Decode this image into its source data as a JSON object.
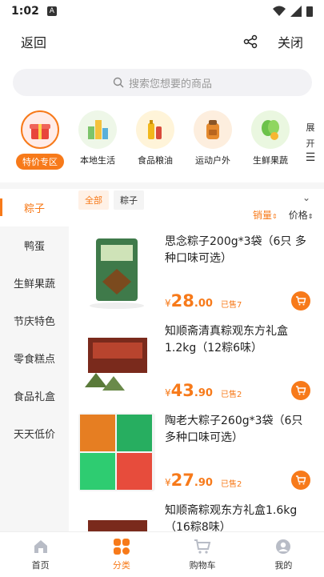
{
  "status_bar": {
    "time": "1:02",
    "notif": "A"
  },
  "header": {
    "back_label": "返回",
    "close_label": "关闭"
  },
  "search": {
    "placeholder": "搜索您想要的商品"
  },
  "categories": [
    {
      "label": "特价专区",
      "icon": "gift-box-icon",
      "active": true
    },
    {
      "label": "本地生活",
      "icon": "city-buildings-icon"
    },
    {
      "label": "食品粮油",
      "icon": "oil-bottles-icon"
    },
    {
      "label": "运动户外",
      "icon": "backpack-icon"
    },
    {
      "label": "生鲜果蔬",
      "icon": "vegetables-icon"
    }
  ],
  "expand_label": "展开",
  "sidebar": [
    {
      "label": "粽子",
      "active": true
    },
    {
      "label": "鸭蛋"
    },
    {
      "label": "生鲜果蔬"
    },
    {
      "label": "节庆特色"
    },
    {
      "label": "零食糕点"
    },
    {
      "label": "食品礼盒"
    },
    {
      "label": "天天低价"
    }
  ],
  "filters": {
    "all": "全部",
    "zongzi": "粽子",
    "sort_sales": "销量",
    "sort_price": "价格"
  },
  "products": [
    {
      "title": "思念粽子200g*3袋（6只 多种口味可选）",
      "currency": "¥",
      "price_int": "28",
      "price_dec": ".00",
      "sold": "已售7"
    },
    {
      "title": "知顺斋清真粽观东方礼盒1.2kg（12粽6味）",
      "currency": "¥",
      "price_int": "43",
      "price_dec": ".90",
      "sold": "已售2"
    },
    {
      "title": "陶老大粽子260g*3袋（6只多种口味可选）",
      "currency": "¥",
      "price_int": "27",
      "price_dec": ".90",
      "sold": "已售2"
    },
    {
      "title": "知顺斋粽观东方礼盒1.6kg（16粽8味）",
      "currency": "¥",
      "price_int": "",
      "price_dec": "",
      "sold": ""
    }
  ],
  "bottom_nav": [
    {
      "label": "首页",
      "icon": "home-icon"
    },
    {
      "label": "分类",
      "icon": "category-icon",
      "active": true
    },
    {
      "label": "购物车",
      "icon": "cart-icon"
    },
    {
      "label": "我的",
      "icon": "profile-icon"
    }
  ],
  "colors": {
    "accent": "#f77a1a"
  }
}
